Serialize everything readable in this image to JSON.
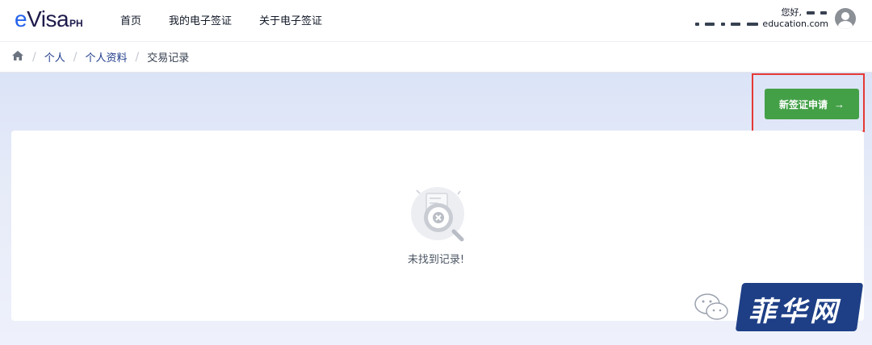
{
  "brand": {
    "logo_prefix": "e",
    "logo_main": "Visa",
    "logo_sub": "PH"
  },
  "nav": {
    "items": [
      {
        "label": "首页"
      },
      {
        "label": "我的电子签证"
      },
      {
        "label": "关于电子签证"
      }
    ]
  },
  "user": {
    "greeting": "您好,",
    "email_suffix": "education.com"
  },
  "breadcrumb": {
    "items": [
      {
        "label": "个人"
      },
      {
        "label": "个人资料"
      },
      {
        "label": "交易记录"
      }
    ]
  },
  "actions": {
    "new_application_label": "新签证申请",
    "arrow": "→"
  },
  "empty_state": {
    "message": "未找到记录!"
  },
  "watermark": {
    "text": "菲华网"
  },
  "colors": {
    "primary_button": "#43a047",
    "highlight_border": "#e53935",
    "brand_blue": "#2563eb",
    "watermark_bg": "#1e3f86"
  }
}
